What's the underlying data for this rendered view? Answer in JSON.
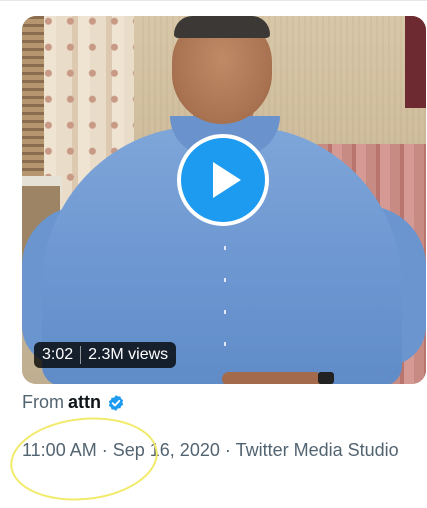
{
  "video": {
    "duration": "3:02",
    "views": "2.3M views"
  },
  "attribution": {
    "from_label": "From",
    "author": "attn"
  },
  "meta": {
    "time": "11:00 AM",
    "separator1": "·",
    "date": "Sep 16, 2020",
    "separator2": "·",
    "source": "Twitter Media Studio"
  },
  "icons": {
    "play": "play-icon",
    "verified": "verified-badge-icon"
  },
  "colors": {
    "accent": "#1d9bf0",
    "secondary_text": "#536471",
    "primary_text": "#0f1419",
    "annotation": "#f2ea6a"
  }
}
